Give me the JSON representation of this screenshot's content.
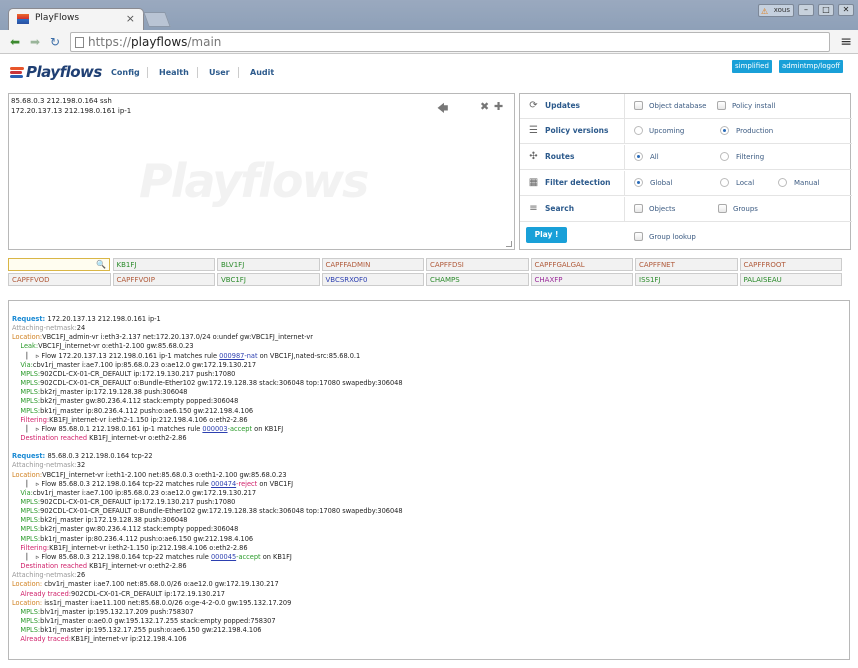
{
  "browser": {
    "tab_title": "PlayFlows",
    "tab_close": "×",
    "user_label": "xous",
    "url_prefix": "https://",
    "url_host": "playflows",
    "url_path": "/main",
    "menu_glyph": "≡"
  },
  "app": {
    "logo_text": "Playflows",
    "nav": [
      "Config",
      "Health",
      "User",
      "Audit"
    ],
    "btn_simplified": "simplified",
    "btn_user": "admintmp/logoff"
  },
  "query": {
    "lines": [
      "85.68.0.3 212.198.0.164 ssh",
      "172.20.137.13 212.198.0.161 ip-1"
    ],
    "watermark": "Playflows"
  },
  "options": {
    "updates": {
      "label": "Updates",
      "opt1": "Object database",
      "opt2": "Policy install"
    },
    "policy_versions": {
      "label": "Policy versions",
      "opt1": "Upcoming",
      "opt2": "Production"
    },
    "routes": {
      "label": "Routes",
      "opt1": "All",
      "opt2": "Filtering"
    },
    "filter_detection": {
      "label": "Filter detection",
      "opt1": "Global",
      "opt2": "Local",
      "opt3": "Manual"
    },
    "search": {
      "label": "Search",
      "opt1": "Objects",
      "opt2": "Groups"
    },
    "play": {
      "label": "Play !",
      "opt1": "Group lookup"
    }
  },
  "devices": [
    {
      "name": "KB1FJ",
      "color": "#2a8a2a"
    },
    {
      "name": "BLV1FJ",
      "color": "#2a8a2a"
    },
    {
      "name": "CAPFFADMIN",
      "color": "#b05a3a"
    },
    {
      "name": "CAPFFDSI",
      "color": "#b05a3a"
    },
    {
      "name": "CAPFFGALGAL",
      "color": "#b05a3a"
    },
    {
      "name": "CAPFFNET",
      "color": "#b05a3a"
    },
    {
      "name": "CAPFFROOT",
      "color": "#b05a3a"
    },
    {
      "name": "CAPFFVOD",
      "color": "#b05a3a"
    },
    {
      "name": "CAPFFVOIP",
      "color": "#b05a3a"
    },
    {
      "name": "VBC1FJ",
      "color": "#2a8a2a"
    },
    {
      "name": "VBCSRXOF0",
      "color": "#2c3fb0"
    },
    {
      "name": "CHAMPS",
      "color": "#2a8a2a"
    },
    {
      "name": "CHAXFP",
      "color": "#9a2a9a"
    },
    {
      "name": "ISS1FJ",
      "color": "#2a8a2a"
    },
    {
      "name": "PALAISEAU",
      "color": "#2a8a2a"
    }
  ],
  "result_lines": [
    [
      {
        "t": "Request: ",
        "c": "#1a8ad4",
        "b": 1
      },
      {
        "t": "172.20.137.13 212.198.0.161 ip-1"
      }
    ],
    [
      {
        "t": "Attaching-netmask:",
        "c": "#999"
      },
      {
        "t": "24"
      }
    ],
    [
      {
        "t": "Location:",
        "c": "#d08020"
      },
      {
        "t": "VBC1FJ_admin-vr i:eth3-2.137 net:172.20.137.0/24 o:undef gw:VBC1FJ_internet-vr"
      }
    ],
    [
      {
        "t": "    Leak:",
        "c": "#2a9a2a"
      },
      {
        "t": "VBC1FJ_internet-vr o:eth1-2.100 gw:85.68.0.23"
      }
    ],
    [
      {
        "t": "       ▏  ▹ Flow 172.20.137.13 212.198.0.161 ip-1 matches rule "
      },
      {
        "t": "000987",
        "c": "#2c3fb0",
        "u": 1
      },
      {
        "t": "-nat",
        "c": "#2c3fb0"
      },
      {
        "t": " on VBC1FJ,nated-src:85.68.0.1"
      }
    ],
    [
      {
        "t": "    Via:",
        "c": "#2a9a2a"
      },
      {
        "t": "cbv1rj_master i:ae7.100 ip:85.68.0.23 o:ae12.0 gw:172.19.130.217"
      }
    ],
    [
      {
        "t": "    MPLS:",
        "c": "#2a9a2a"
      },
      {
        "t": "902CDL-CX-01-CR_DEFAULT ip:172.19.130.217 push:17080"
      }
    ],
    [
      {
        "t": "    MPLS:",
        "c": "#2a9a2a"
      },
      {
        "t": "902CDL-CX-01-CR_DEFAULT o:Bundle-Ether102 gw:172.19.128.38 stack:306048 top:17080 swapedby:306048"
      }
    ],
    [
      {
        "t": "    MPLS:",
        "c": "#2a9a2a"
      },
      {
        "t": "bk2rj_master ip:172.19.128.38 push:306048"
      }
    ],
    [
      {
        "t": "    MPLS:",
        "c": "#2a9a2a"
      },
      {
        "t": "bk2rj_master gw:80.236.4.112 stack:empty popped:306048"
      }
    ],
    [
      {
        "t": "    MPLS:",
        "c": "#2a9a2a"
      },
      {
        "t": "bk1rj_master ip:80.236.4.112 push:o:ae6.150 gw:212.198.4.106"
      }
    ],
    [
      {
        "t": "    Filtering:",
        "c": "#d0206a"
      },
      {
        "t": "KB1FJ_internet-vr i:eth2-1.150 ip:212.198.4.106 o:eth2-2.86"
      }
    ],
    [
      {
        "t": "       ▏  ▹ Flow 85.68.0.1 212.198.0.161 ip-1 matches rule "
      },
      {
        "t": "000003",
        "c": "#2c3fb0",
        "u": 1
      },
      {
        "t": "-accept",
        "c": "#2a9a2a"
      },
      {
        "t": " on KB1FJ"
      }
    ],
    [
      {
        "t": "    Destination reached ",
        "c": "#d0206a"
      },
      {
        "t": "KB1FJ_internet-vr o:eth2-2.86"
      }
    ],
    [
      {
        "t": ""
      }
    ],
    [
      {
        "t": "Request: ",
        "c": "#1a8ad4",
        "b": 1
      },
      {
        "t": "85.68.0.3 212.198.0.164 tcp-22"
      }
    ],
    [
      {
        "t": "Attaching-netmask:",
        "c": "#999"
      },
      {
        "t": "32"
      }
    ],
    [
      {
        "t": "Location:",
        "c": "#d08020"
      },
      {
        "t": "VBC1FJ_internet-vr i:eth1-2.100 net:85.68.0.3 o:eth1-2.100 gw:85.68.0.23"
      }
    ],
    [
      {
        "t": "       ▏  ▹ Flow 85.68.0.3 212.198.0.164 tcp-22 matches rule "
      },
      {
        "t": "000474",
        "c": "#2c3fb0",
        "u": 1
      },
      {
        "t": "-reject",
        "c": "#d0206a"
      },
      {
        "t": " on VBC1FJ"
      }
    ],
    [
      {
        "t": "    Via:",
        "c": "#2a9a2a"
      },
      {
        "t": "cbv1rj_master i:ae7.100 ip:85.68.0.23 o:ae12.0 gw:172.19.130.217"
      }
    ],
    [
      {
        "t": "    MPLS:",
        "c": "#2a9a2a"
      },
      {
        "t": "902CDL-CX-01-CR_DEFAULT ip:172.19.130.217 push:17080"
      }
    ],
    [
      {
        "t": "    MPLS:",
        "c": "#2a9a2a"
      },
      {
        "t": "902CDL-CX-01-CR_DEFAULT o:Bundle-Ether102 gw:172.19.128.38 stack:306048 top:17080 swapedby:306048"
      }
    ],
    [
      {
        "t": "    MPLS:",
        "c": "#2a9a2a"
      },
      {
        "t": "bk2rj_master ip:172.19.128.38 push:306048"
      }
    ],
    [
      {
        "t": "    MPLS:",
        "c": "#2a9a2a"
      },
      {
        "t": "bk2rj_master gw:80.236.4.112 stack:empty popped:306048"
      }
    ],
    [
      {
        "t": "    MPLS:",
        "c": "#2a9a2a"
      },
      {
        "t": "bk1rj_master ip:80.236.4.112 push:o:ae6.150 gw:212.198.4.106"
      }
    ],
    [
      {
        "t": "    Filtering:",
        "c": "#d0206a"
      },
      {
        "t": "KB1FJ_internet-vr i:eth2-1.150 ip:212.198.4.106 o:eth2-2.86"
      }
    ],
    [
      {
        "t": "       ▏  ▹ Flow 85.68.0.3 212.198.0.164 tcp-22 matches rule "
      },
      {
        "t": "000045",
        "c": "#2c3fb0",
        "u": 1
      },
      {
        "t": "-accept",
        "c": "#2a9a2a"
      },
      {
        "t": " on KB1FJ"
      }
    ],
    [
      {
        "t": "    Destination reached ",
        "c": "#d0206a"
      },
      {
        "t": "KB1FJ_internet-vr o:eth2-2.86"
      }
    ],
    [
      {
        "t": "Attaching-netmask:",
        "c": "#999"
      },
      {
        "t": "26"
      }
    ],
    [
      {
        "t": "Location:",
        "c": "#d08020"
      },
      {
        "t": " cbv1rj_master i:ae7.100 net:85.68.0.0/26 o:ae12.0 gw:172.19.130.217"
      }
    ],
    [
      {
        "t": "    Already traced:",
        "c": "#d0206a"
      },
      {
        "t": "902CDL-CX-01-CR_DEFAULT ip:172.19.130.217"
      }
    ],
    [
      {
        "t": "Location:",
        "c": "#d08020"
      },
      {
        "t": " iss1rj_master i:ae11.100 net:85.68.0.0/26 o:ge-4-2-0.0 gw:195.132.17.209"
      }
    ],
    [
      {
        "t": "    MPLS:",
        "c": "#2a9a2a"
      },
      {
        "t": "blv1rj_master ip:195.132.17.209 push:758307"
      }
    ],
    [
      {
        "t": "    MPLS:",
        "c": "#2a9a2a"
      },
      {
        "t": "blv1rj_master o:ae0.0 gw:195.132.17.255 stack:empty popped:758307"
      }
    ],
    [
      {
        "t": "    MPLS:",
        "c": "#2a9a2a"
      },
      {
        "t": "bk1rj_master ip:195.132.17.255 push:o:ae6.150 gw:212.198.4.106"
      }
    ],
    [
      {
        "t": "    Already traced:",
        "c": "#d0206a"
      },
      {
        "t": "KB1FJ_internet-vr ip:212.198.4.106"
      }
    ]
  ]
}
